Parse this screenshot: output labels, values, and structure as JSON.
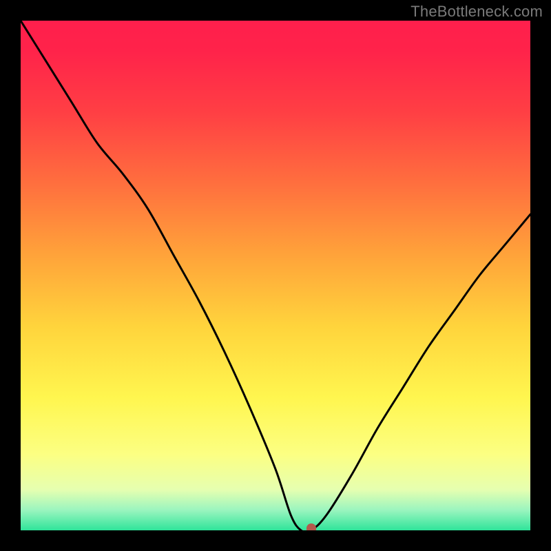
{
  "watermark": "TheBottleneck.com",
  "chart_data": {
    "type": "line",
    "title": "",
    "xlabel": "",
    "ylabel": "",
    "xlim": [
      0,
      100
    ],
    "ylim": [
      0,
      100
    ],
    "grid": false,
    "legend": false,
    "series": [
      {
        "name": "bottleneck-curve",
        "x": [
          0,
          5,
          10,
          15,
          20,
          25,
          30,
          35,
          40,
          45,
          50,
          53,
          55,
          57,
          60,
          65,
          70,
          75,
          80,
          85,
          90,
          95,
          100
        ],
        "y": [
          100,
          92,
          84,
          76,
          70,
          63,
          54,
          45,
          35,
          24,
          12,
          3,
          0,
          0,
          3,
          11,
          20,
          28,
          36,
          43,
          50,
          56,
          62
        ]
      }
    ],
    "marker": {
      "x": 57,
      "y": 0,
      "color": "#b35a4d"
    },
    "gradient_stops": [
      {
        "pct": 0,
        "color": "#ff1f4c"
      },
      {
        "pct": 6,
        "color": "#ff234a"
      },
      {
        "pct": 18,
        "color": "#ff3f44"
      },
      {
        "pct": 32,
        "color": "#ff6f3e"
      },
      {
        "pct": 46,
        "color": "#ffa33a"
      },
      {
        "pct": 60,
        "color": "#ffd43c"
      },
      {
        "pct": 74,
        "color": "#fff64f"
      },
      {
        "pct": 85,
        "color": "#fcff82"
      },
      {
        "pct": 92,
        "color": "#e6ffb0"
      },
      {
        "pct": 96,
        "color": "#9bf5bf"
      },
      {
        "pct": 100,
        "color": "#2fe49a"
      }
    ]
  }
}
